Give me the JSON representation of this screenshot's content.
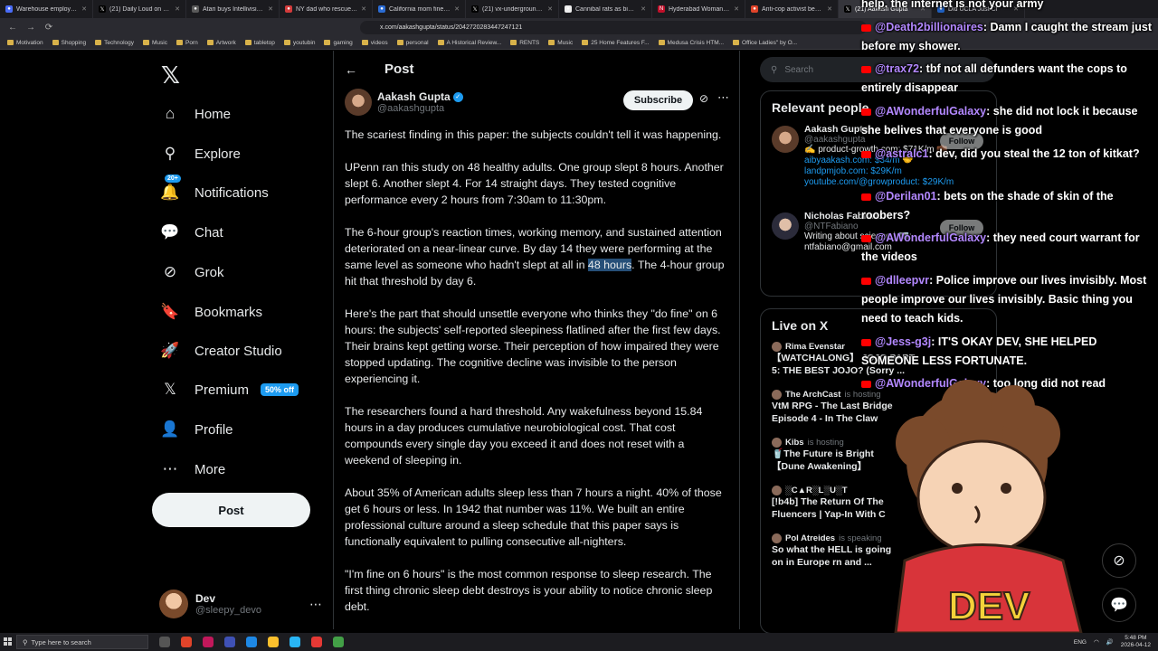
{
  "browser": {
    "tabs": [
      {
        "label": "Warehouse employee ar",
        "color": "#4a6cf7",
        "glyph": "●"
      },
      {
        "label": "(21) Daily Loud on X: \"",
        "color": "#000000",
        "glyph": "𝕏"
      },
      {
        "label": "Atari buys Intellivision,",
        "color": "#5a5a5a",
        "glyph": "●"
      },
      {
        "label": "NY dad who rescued ar",
        "color": "#d33b3b",
        "glyph": "●"
      },
      {
        "label": "California mom fined 5",
        "color": "#2b6cd4",
        "glyph": "●"
      },
      {
        "label": "(21) vx-underground on",
        "color": "#000000",
        "glyph": "𝕏"
      },
      {
        "label": "Cannibal rats as big as",
        "color": "#eeeeee",
        "glyph": "●"
      },
      {
        "label": "Hyderabad Woman Kill",
        "color": "#c0102a",
        "glyph": "N"
      },
      {
        "label": "Anti-cop activist begs c",
        "color": "#e0442a",
        "glyph": "●"
      },
      {
        "label": "(21) Aakash Gupta",
        "color": "#000000",
        "glyph": "𝕏",
        "active": true
      },
      {
        "label": "Did UCLA Just Cl",
        "color": "#1f5fbf",
        "glyph": "●"
      }
    ],
    "url": "x.com/aakashgupta/status/2042720283447247121",
    "bookmarks": [
      "Motivation",
      "Shopping",
      "Technology",
      "Music",
      "Porn",
      "Artwork",
      "tabletop",
      "youtubin",
      "gaming",
      "videos",
      "personal",
      "A Historical Review...",
      "RENTS",
      "Music",
      "25 Home Features F...",
      "Medusa Crisis HTM...",
      "Office Ladies\" by O..."
    ]
  },
  "nav": {
    "logo": "𝕏",
    "items": [
      {
        "label": "Home",
        "icon": "home-icon",
        "glyph": "⌂"
      },
      {
        "label": "Explore",
        "icon": "search-icon",
        "glyph": "⚲"
      },
      {
        "label": "Notifications",
        "icon": "bell-icon",
        "glyph": "🔔"
      },
      {
        "label": "Chat",
        "icon": "chat-icon",
        "glyph": "💬"
      },
      {
        "label": "Grok",
        "icon": "grok-icon",
        "glyph": "⊘"
      },
      {
        "label": "Bookmarks",
        "icon": "bookmark-icon",
        "glyph": "🔖"
      },
      {
        "label": "Creator Studio",
        "icon": "rocket-icon",
        "glyph": "🚀"
      },
      {
        "label": "Premium",
        "icon": "x-logo-icon",
        "glyph": "𝕏"
      },
      {
        "label": "Profile",
        "icon": "person-icon",
        "glyph": "👤"
      },
      {
        "label": "More",
        "icon": "more-icon",
        "glyph": "⋯"
      }
    ],
    "notif_badge": "20+",
    "premium_badge": "50% off",
    "post_button": "Post",
    "user": {
      "name": "Dev",
      "handle": "@sleepy_devo"
    }
  },
  "post": {
    "header_title": "Post",
    "author_name": "Aakash Gupta",
    "author_handle": "@aakashgupta",
    "subscribe_label": "Subscribe",
    "paragraphs": {
      "p1": "The scariest finding in this paper: the subjects couldn't tell it was happening.",
      "p2": "UPenn ran this study on 48 healthy adults. One group slept 8 hours. Another slept 6. Another slept 4. For 14 straight days. They tested cognitive performance every 2 hours from 7:30am to 11:30pm.",
      "p3a": "The 6-hour group's reaction times, working memory, and sustained attention deteriorated on a near-linear curve. By day 14 they were performing at the same level as someone who hadn't slept at all in ",
      "p3hl": "48 hours",
      "p3b": ". The 4-hour group hit that threshold by day 6.",
      "p4": "Here's the part that should unsettle everyone who thinks they \"do fine\" on 6 hours: the subjects' self-reported sleepiness flatlined after the first few days. Their brains kept getting worse. Their perception of how impaired they were stopped updating. The cognitive decline was invisible to the person experiencing it.",
      "p5": "The researchers found a hard threshold. Any wakefulness beyond 15.84 hours in a day produces cumulative neurobiological cost. That cost compounds every single day you exceed it and does not reset with a weekend of sleeping in.",
      "p6": "About 35% of American adults sleep less than 7 hours a night. 40% of those get 6 hours or less. In 1942 that number was 11%. We built an entire professional culture around a sleep schedule that this paper says is functionally equivalent to pulling consecutive all-nighters.",
      "p7": "\"I'm fine on 6 hours\" is the most common response to sleep research. The first thing chronic sleep debt destroys is your ability to notice chronic sleep debt."
    }
  },
  "right": {
    "search_placeholder": "Search",
    "relevant_title": "Relevant people",
    "people": [
      {
        "name": "Aakash Gupta",
        "handle": "@aakashgupta",
        "bio1": "✍️ product-growth.com: $71K/m 💼",
        "bio2": "aibyaakash.com: $34/m 🤝",
        "bio3": "landpmjob.com: $29K/m",
        "bio4": "youtube.com/@growproduct: $29K/m",
        "follow": "Follow"
      },
      {
        "name": "Nicholas Fabiano",
        "handle": "@NTFabiano",
        "bio1": "Writing about science | ✉️:",
        "bio2": "ntfabiano@gmail.com",
        "bio3": "",
        "bio4": "",
        "follow": "Follow"
      }
    ],
    "live_title": "Live on X",
    "live": [
      {
        "host": "Rima Evenstar",
        "status": "",
        "title": "【WATCHALONG】 JOJO PART",
        "title2": "5: THE BEST JOJO? (Sorry ..."
      },
      {
        "host": "The ArchCast",
        "status": "is hosting",
        "title": "VtM RPG - The Last Bridge",
        "title2": "Episode 4 - In The Claw"
      },
      {
        "host": "Kibs",
        "status": "is hosting",
        "title": "🥤The Future is Bright",
        "title2": "【Dune Awakening】"
      },
      {
        "host": "░C▲R░L░U░T",
        "status": "",
        "title": "[!b4b] The Return Of The",
        "title2": "Fluencers | Yap-In With C"
      },
      {
        "host": "Pol Atreides",
        "status": "is speaking",
        "title": "So what the HELL is going",
        "title2": "on in Europe rn and ..."
      }
    ]
  },
  "chat": [
    {
      "user": "",
      "text": "help. the internet is not your army"
    },
    {
      "user": "@Death2billionaires",
      "text": ": Damn I caught the stream just before my shower."
    },
    {
      "user": "@trax72",
      "text": ": tbf not all defunders want the cops to entirely disappear"
    },
    {
      "user": "@AWonderfulGalaxy",
      "text": ": she did not lock it because she belives that everyone is good"
    },
    {
      "user": "@astralc1",
      "text": ": dev, did you steal the 12 ton of kitkat?"
    },
    {
      "user": "@Derilan01",
      "text": ": bets on the shade of skin of the roobers?"
    },
    {
      "user": "@AWonderfulGalaxy",
      "text": ": they need court warrant for the videos"
    },
    {
      "user": "@dlleepvr",
      "text": ": Police improve our lives invisibly. Most people improve our lives invisibly. Basic thing you need to teach kids."
    },
    {
      "user": "@Jess-g3j",
      "text": ": IT'S OKAY DEV, SHE HELPED SOMEONE LESS FORTUNATE."
    },
    {
      "user": "@AWonderfulGalaxy",
      "text": ": too long did not read"
    }
  ],
  "mascot_label": "DEV",
  "taskbar": {
    "search_placeholder": "Type here to search",
    "lang": "ENG",
    "time": "5:48 PM",
    "date": "2026-04-12"
  },
  "colors": {
    "accent": "#1d9bf0",
    "bg": "#000000",
    "chat_user": "#b388ff"
  }
}
